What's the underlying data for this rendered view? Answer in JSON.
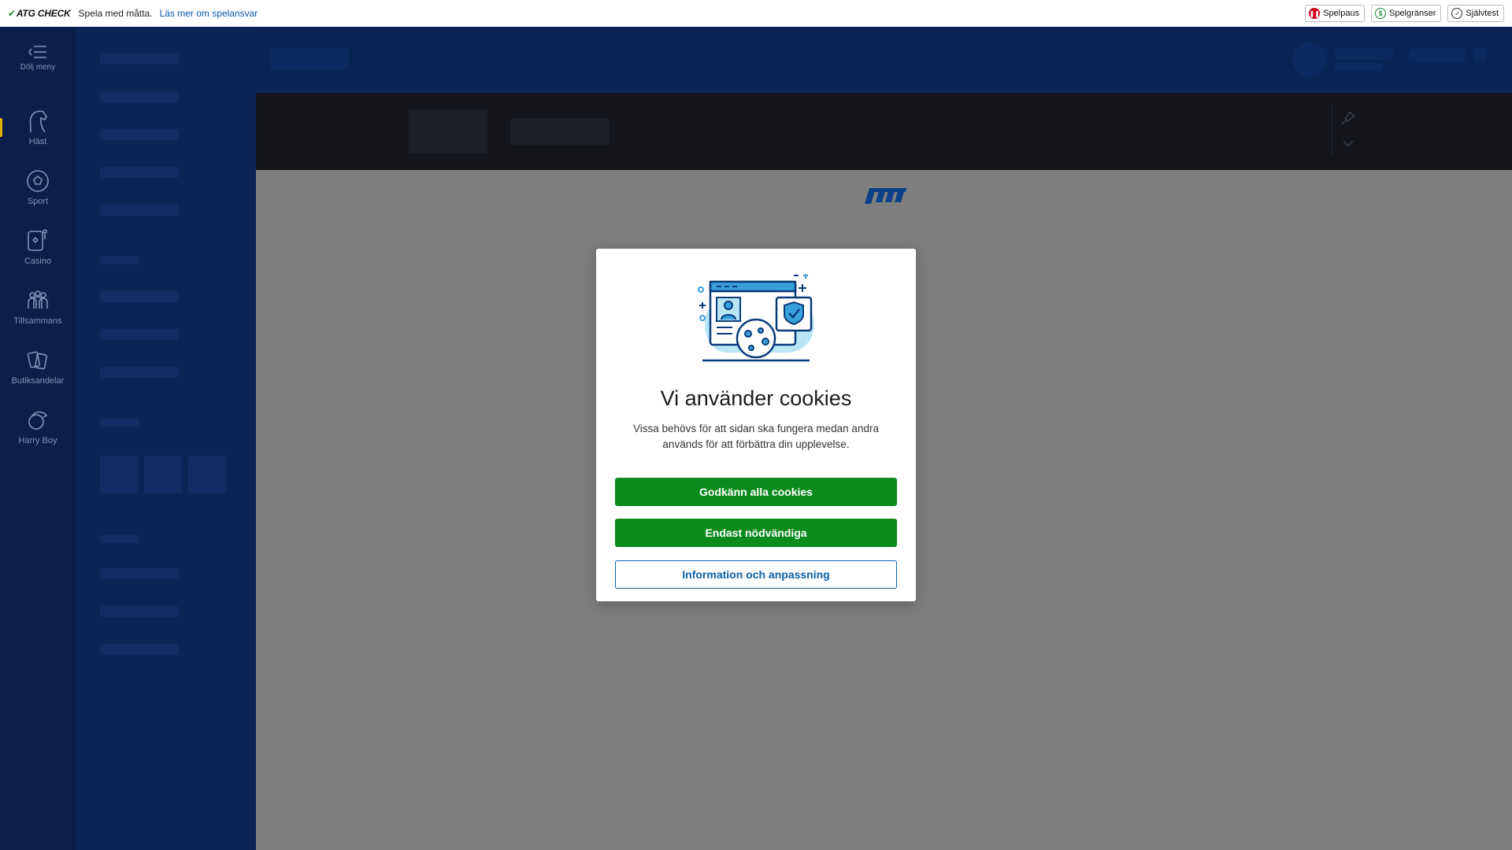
{
  "topbar": {
    "brand": "ATG CHECK",
    "message": "Spela med måtta.",
    "link": "Läs mer om spelansvar",
    "buttons": [
      {
        "label": "Spelpaus",
        "icon": "pause-icon"
      },
      {
        "label": "Spelgränser",
        "icon": "limits-icon"
      },
      {
        "label": "Självtest",
        "icon": "selftest-icon"
      }
    ]
  },
  "rail": {
    "toggle_label": "Dölj meny",
    "items": [
      {
        "label": "Häst",
        "icon": "horse-icon",
        "active": true
      },
      {
        "label": "Sport",
        "icon": "football-icon"
      },
      {
        "label": "Casino",
        "icon": "casino-icon"
      },
      {
        "label": "Tillsammans",
        "icon": "group-icon"
      },
      {
        "label": "Butiksandelar",
        "icon": "cards-icon"
      },
      {
        "label": "Harry Boy",
        "icon": "harry-boy-icon"
      }
    ]
  },
  "modal": {
    "title": "Vi använder cookies",
    "text": "Vissa behövs för att sidan ska fungera medan andra används för att förbättra din upplevelse.",
    "accept_all": "Godkänn alla cookies",
    "necessary_only": "Endast nödvändiga",
    "info": "Information och anpassning"
  },
  "colors": {
    "accent_green": "#0b8a1e",
    "link_blue": "#0a62a8",
    "rail_bg": "#0b1f4a",
    "active_marker": "#e0b400"
  }
}
